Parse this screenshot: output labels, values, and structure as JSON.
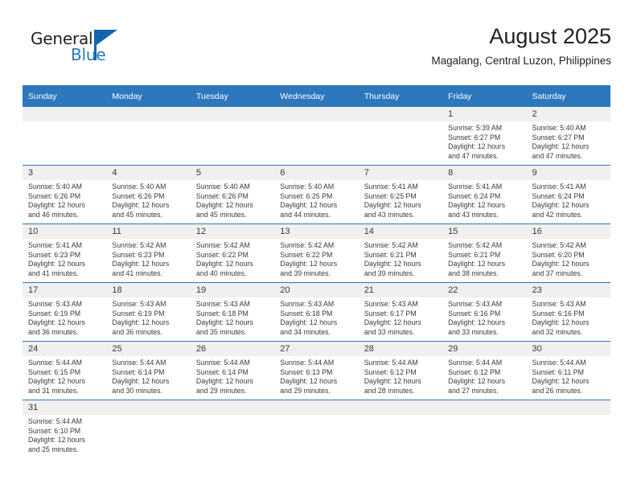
{
  "brand": {
    "name_part1": "General",
    "name_part2": "Blue",
    "flag_icon": "triangle-flag-icon"
  },
  "header": {
    "title": "August 2025",
    "subtitle": "Magalang, Central Luzon, Philippines"
  },
  "calendar": {
    "accent_color": "#2d78bd",
    "daynum_strip_color": "#f0f0f0",
    "weekday_headers": [
      "Sunday",
      "Monday",
      "Tuesday",
      "Wednesday",
      "Thursday",
      "Friday",
      "Saturday"
    ],
    "labels": {
      "sunrise_prefix": "Sunrise:",
      "sunset_prefix": "Sunset:",
      "daylight_prefix": "Daylight:"
    },
    "weeks": [
      [
        {
          "day": "",
          "blank": true
        },
        {
          "day": "",
          "blank": true
        },
        {
          "day": "",
          "blank": true
        },
        {
          "day": "",
          "blank": true
        },
        {
          "day": "",
          "blank": true
        },
        {
          "day": "1",
          "sunrise": "Sunrise: 5:39 AM",
          "sunset": "Sunset: 6:27 PM",
          "daylight_l1": "Daylight: 12 hours",
          "daylight_l2": "and 47 minutes."
        },
        {
          "day": "2",
          "sunrise": "Sunrise: 5:40 AM",
          "sunset": "Sunset: 6:27 PM",
          "daylight_l1": "Daylight: 12 hours",
          "daylight_l2": "and 47 minutes."
        }
      ],
      [
        {
          "day": "3",
          "sunrise": "Sunrise: 5:40 AM",
          "sunset": "Sunset: 6:26 PM",
          "daylight_l1": "Daylight: 12 hours",
          "daylight_l2": "and 46 minutes."
        },
        {
          "day": "4",
          "sunrise": "Sunrise: 5:40 AM",
          "sunset": "Sunset: 6:26 PM",
          "daylight_l1": "Daylight: 12 hours",
          "daylight_l2": "and 45 minutes."
        },
        {
          "day": "5",
          "sunrise": "Sunrise: 5:40 AM",
          "sunset": "Sunset: 6:26 PM",
          "daylight_l1": "Daylight: 12 hours",
          "daylight_l2": "and 45 minutes."
        },
        {
          "day": "6",
          "sunrise": "Sunrise: 5:40 AM",
          "sunset": "Sunset: 6:25 PM",
          "daylight_l1": "Daylight: 12 hours",
          "daylight_l2": "and 44 minutes."
        },
        {
          "day": "7",
          "sunrise": "Sunrise: 5:41 AM",
          "sunset": "Sunset: 6:25 PM",
          "daylight_l1": "Daylight: 12 hours",
          "daylight_l2": "and 43 minutes."
        },
        {
          "day": "8",
          "sunrise": "Sunrise: 5:41 AM",
          "sunset": "Sunset: 6:24 PM",
          "daylight_l1": "Daylight: 12 hours",
          "daylight_l2": "and 43 minutes."
        },
        {
          "day": "9",
          "sunrise": "Sunrise: 5:41 AM",
          "sunset": "Sunset: 6:24 PM",
          "daylight_l1": "Daylight: 12 hours",
          "daylight_l2": "and 42 minutes."
        }
      ],
      [
        {
          "day": "10",
          "sunrise": "Sunrise: 5:41 AM",
          "sunset": "Sunset: 6:23 PM",
          "daylight_l1": "Daylight: 12 hours",
          "daylight_l2": "and 41 minutes."
        },
        {
          "day": "11",
          "sunrise": "Sunrise: 5:42 AM",
          "sunset": "Sunset: 6:23 PM",
          "daylight_l1": "Daylight: 12 hours",
          "daylight_l2": "and 41 minutes."
        },
        {
          "day": "12",
          "sunrise": "Sunrise: 5:42 AM",
          "sunset": "Sunset: 6:22 PM",
          "daylight_l1": "Daylight: 12 hours",
          "daylight_l2": "and 40 minutes."
        },
        {
          "day": "13",
          "sunrise": "Sunrise: 5:42 AM",
          "sunset": "Sunset: 6:22 PM",
          "daylight_l1": "Daylight: 12 hours",
          "daylight_l2": "and 39 minutes."
        },
        {
          "day": "14",
          "sunrise": "Sunrise: 5:42 AM",
          "sunset": "Sunset: 6:21 PM",
          "daylight_l1": "Daylight: 12 hours",
          "daylight_l2": "and 39 minutes."
        },
        {
          "day": "15",
          "sunrise": "Sunrise: 5:42 AM",
          "sunset": "Sunset: 6:21 PM",
          "daylight_l1": "Daylight: 12 hours",
          "daylight_l2": "and 38 minutes."
        },
        {
          "day": "16",
          "sunrise": "Sunrise: 5:42 AM",
          "sunset": "Sunset: 6:20 PM",
          "daylight_l1": "Daylight: 12 hours",
          "daylight_l2": "and 37 minutes."
        }
      ],
      [
        {
          "day": "17",
          "sunrise": "Sunrise: 5:43 AM",
          "sunset": "Sunset: 6:19 PM",
          "daylight_l1": "Daylight: 12 hours",
          "daylight_l2": "and 36 minutes."
        },
        {
          "day": "18",
          "sunrise": "Sunrise: 5:43 AM",
          "sunset": "Sunset: 6:19 PM",
          "daylight_l1": "Daylight: 12 hours",
          "daylight_l2": "and 36 minutes."
        },
        {
          "day": "19",
          "sunrise": "Sunrise: 5:43 AM",
          "sunset": "Sunset: 6:18 PM",
          "daylight_l1": "Daylight: 12 hours",
          "daylight_l2": "and 35 minutes."
        },
        {
          "day": "20",
          "sunrise": "Sunrise: 5:43 AM",
          "sunset": "Sunset: 6:18 PM",
          "daylight_l1": "Daylight: 12 hours",
          "daylight_l2": "and 34 minutes."
        },
        {
          "day": "21",
          "sunrise": "Sunrise: 5:43 AM",
          "sunset": "Sunset: 6:17 PM",
          "daylight_l1": "Daylight: 12 hours",
          "daylight_l2": "and 33 minutes."
        },
        {
          "day": "22",
          "sunrise": "Sunrise: 5:43 AM",
          "sunset": "Sunset: 6:16 PM",
          "daylight_l1": "Daylight: 12 hours",
          "daylight_l2": "and 33 minutes."
        },
        {
          "day": "23",
          "sunrise": "Sunrise: 5:43 AM",
          "sunset": "Sunset: 6:16 PM",
          "daylight_l1": "Daylight: 12 hours",
          "daylight_l2": "and 32 minutes."
        }
      ],
      [
        {
          "day": "24",
          "sunrise": "Sunrise: 5:44 AM",
          "sunset": "Sunset: 6:15 PM",
          "daylight_l1": "Daylight: 12 hours",
          "daylight_l2": "and 31 minutes."
        },
        {
          "day": "25",
          "sunrise": "Sunrise: 5:44 AM",
          "sunset": "Sunset: 6:14 PM",
          "daylight_l1": "Daylight: 12 hours",
          "daylight_l2": "and 30 minutes."
        },
        {
          "day": "26",
          "sunrise": "Sunrise: 5:44 AM",
          "sunset": "Sunset: 6:14 PM",
          "daylight_l1": "Daylight: 12 hours",
          "daylight_l2": "and 29 minutes."
        },
        {
          "day": "27",
          "sunrise": "Sunrise: 5:44 AM",
          "sunset": "Sunset: 6:13 PM",
          "daylight_l1": "Daylight: 12 hours",
          "daylight_l2": "and 29 minutes."
        },
        {
          "day": "28",
          "sunrise": "Sunrise: 5:44 AM",
          "sunset": "Sunset: 6:12 PM",
          "daylight_l1": "Daylight: 12 hours",
          "daylight_l2": "and 28 minutes."
        },
        {
          "day": "29",
          "sunrise": "Sunrise: 5:44 AM",
          "sunset": "Sunset: 6:12 PM",
          "daylight_l1": "Daylight: 12 hours",
          "daylight_l2": "and 27 minutes."
        },
        {
          "day": "30",
          "sunrise": "Sunrise: 5:44 AM",
          "sunset": "Sunset: 6:11 PM",
          "daylight_l1": "Daylight: 12 hours",
          "daylight_l2": "and 26 minutes."
        }
      ],
      [
        {
          "day": "31",
          "sunrise": "Sunrise: 5:44 AM",
          "sunset": "Sunset: 6:10 PM",
          "daylight_l1": "Daylight: 12 hours",
          "daylight_l2": "and 25 minutes."
        },
        {
          "day": "",
          "blank": true
        },
        {
          "day": "",
          "blank": true
        },
        {
          "day": "",
          "blank": true
        },
        {
          "day": "",
          "blank": true
        },
        {
          "day": "",
          "blank": true
        },
        {
          "day": "",
          "blank": true
        }
      ]
    ]
  }
}
